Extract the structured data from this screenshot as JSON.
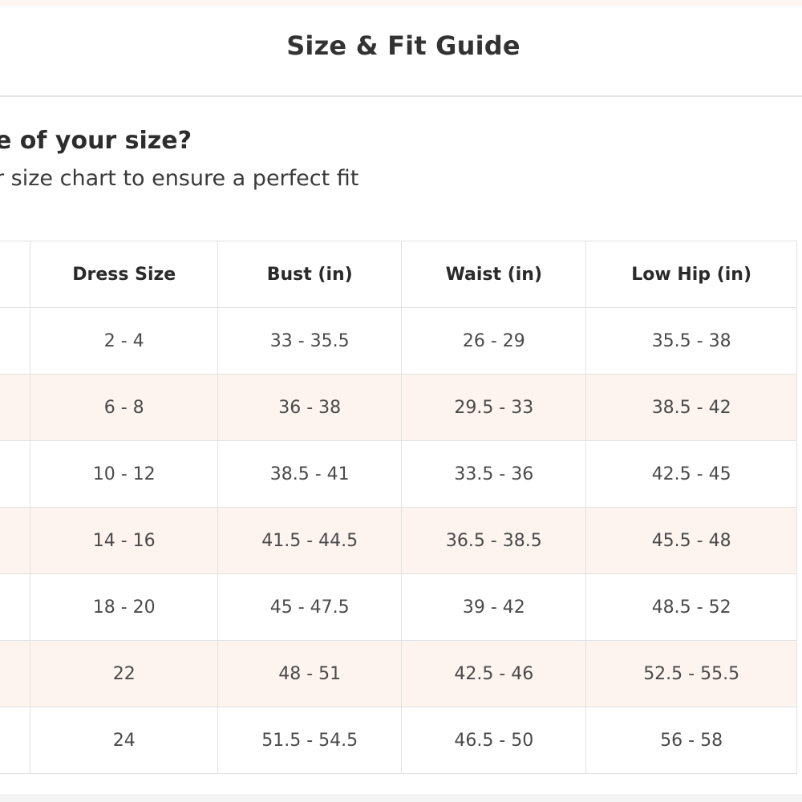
{
  "modal": {
    "title": "Size & Fit Guide"
  },
  "intro": {
    "question": "e of your size?",
    "subtext": "r size chart to ensure a perfect fit"
  },
  "table": {
    "headers": [
      "",
      "Dress Size",
      "Bust (in)",
      "Waist (in)",
      "Low Hip (in)"
    ],
    "rows": [
      [
        "",
        "2 - 4",
        "33 - 35.5",
        "26 - 29",
        "35.5 - 38"
      ],
      [
        "",
        "6 - 8",
        "36 - 38",
        "29.5 - 33",
        "38.5 - 42"
      ],
      [
        "",
        "10 - 12",
        "38.5 - 41",
        "33.5 - 36",
        "42.5 - 45"
      ],
      [
        "",
        "14 - 16",
        "41.5 - 44.5",
        "36.5 - 38.5",
        "45.5 - 48"
      ],
      [
        "",
        "18 - 20",
        "45 - 47.5",
        "39 - 42",
        "48.5 - 52"
      ],
      [
        "",
        "22",
        "48 - 51",
        "42.5 - 46",
        "52.5 - 55.5"
      ],
      [
        "",
        "24",
        "51.5 - 54.5",
        "46.5 - 50",
        "56 - 58"
      ]
    ]
  },
  "colors": {
    "shaded_row": "#fdf4ef",
    "border": "#e2e2e2",
    "text": "#2d2d2d"
  }
}
